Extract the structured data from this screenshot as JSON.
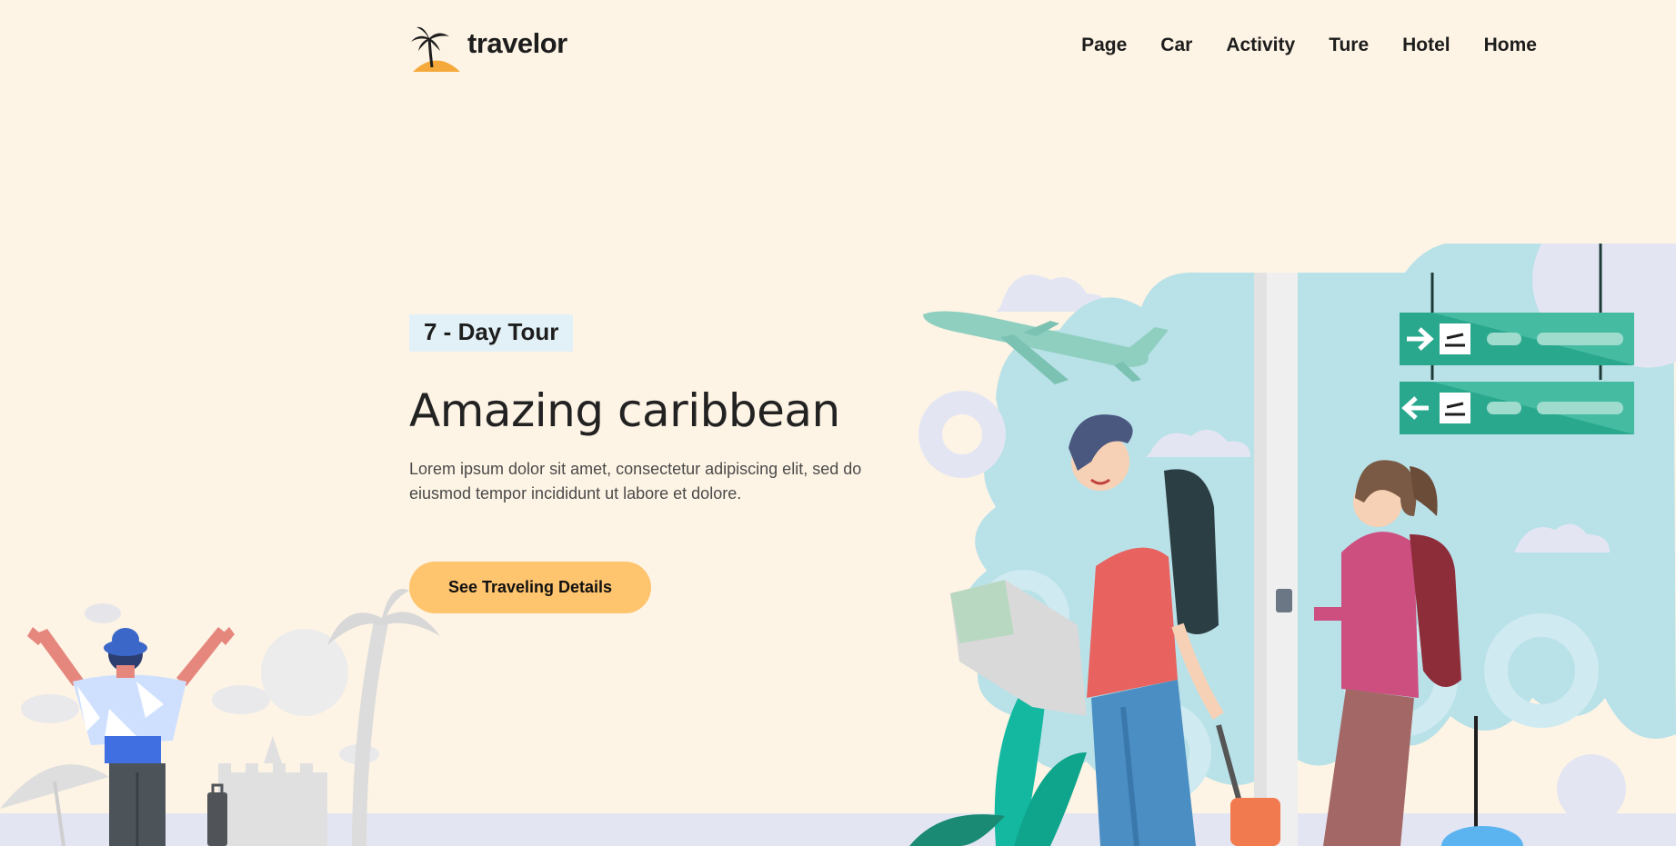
{
  "header": {
    "logo_text": "travelor",
    "nav": [
      "Page",
      "Car",
      "Activity",
      "Ture",
      "Hotel",
      "Home"
    ]
  },
  "hero": {
    "badge": "7 - Day Tour",
    "title": "Amazing caribbean",
    "description": "Lorem ipsum dolor sit amet, consectetur adipiscing elit, sed do eiusmod tempor incididunt ut labore et dolore.",
    "cta_label": "See Traveling Details"
  },
  "colors": {
    "background": "#fef4e5",
    "accent": "#ffc46e",
    "badge_bg": "#e2f1f7",
    "sign_green": "#2aa88e"
  },
  "icons": [
    "palm-tree-logo-icon",
    "airplane-illustration",
    "departure-sign-icon",
    "arrival-sign-icon"
  ]
}
